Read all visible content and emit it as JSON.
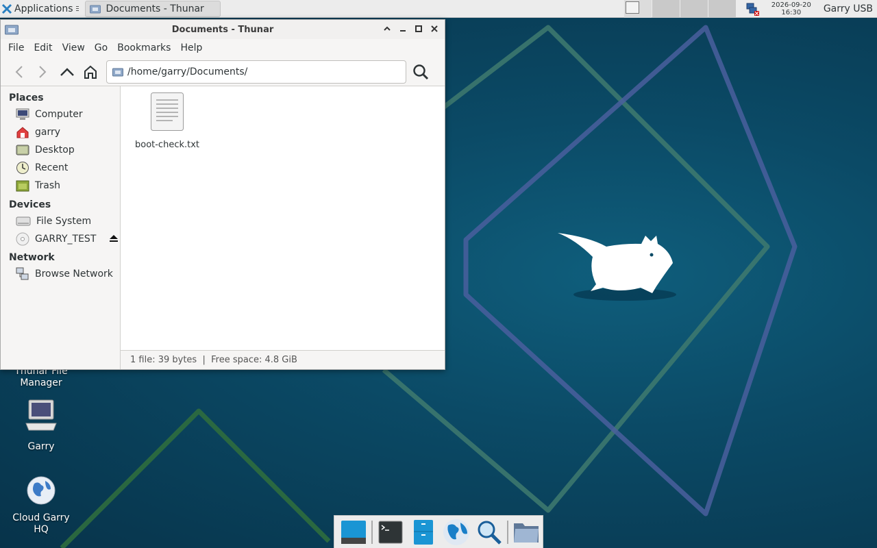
{
  "panel": {
    "apps_label": "Applications",
    "task_title": "Documents - Thunar",
    "clock_date": "2026-09-20",
    "clock_time": "16:30",
    "user": "Garry USB"
  },
  "window": {
    "title": "Documents - Thunar",
    "menu": [
      "File",
      "Edit",
      "View",
      "Go",
      "Bookmarks",
      "Help"
    ],
    "location": "/home/garry/Documents/",
    "sidebar": {
      "places_heading": "Places",
      "places": [
        "Computer",
        "garry",
        "Desktop",
        "Recent",
        "Trash"
      ],
      "devices_heading": "Devices",
      "devices": [
        "File System",
        "GARRY_TEST"
      ],
      "network_heading": "Network",
      "network": [
        "Browse Network"
      ]
    },
    "files": [
      {
        "name": "boot-check.txt"
      }
    ],
    "status": "1 file: 39 bytes  |  Free space: 4.8 GiB"
  },
  "desktop": {
    "icons": [
      {
        "label_line1": "Thunar File",
        "label_line2": "Manager"
      },
      {
        "label_line1": "Garry",
        "label_line2": ""
      },
      {
        "label_line1": "Cloud Garry",
        "label_line2": "HQ"
      }
    ]
  },
  "dock": {
    "items": [
      "show-desktop-icon",
      "terminal-icon",
      "file-manager-icon",
      "web-browser-icon",
      "app-finder-icon",
      "folder-icon"
    ]
  },
  "colors": {
    "accent": "#1a95d4",
    "wallpaper": "#0b4a66"
  }
}
